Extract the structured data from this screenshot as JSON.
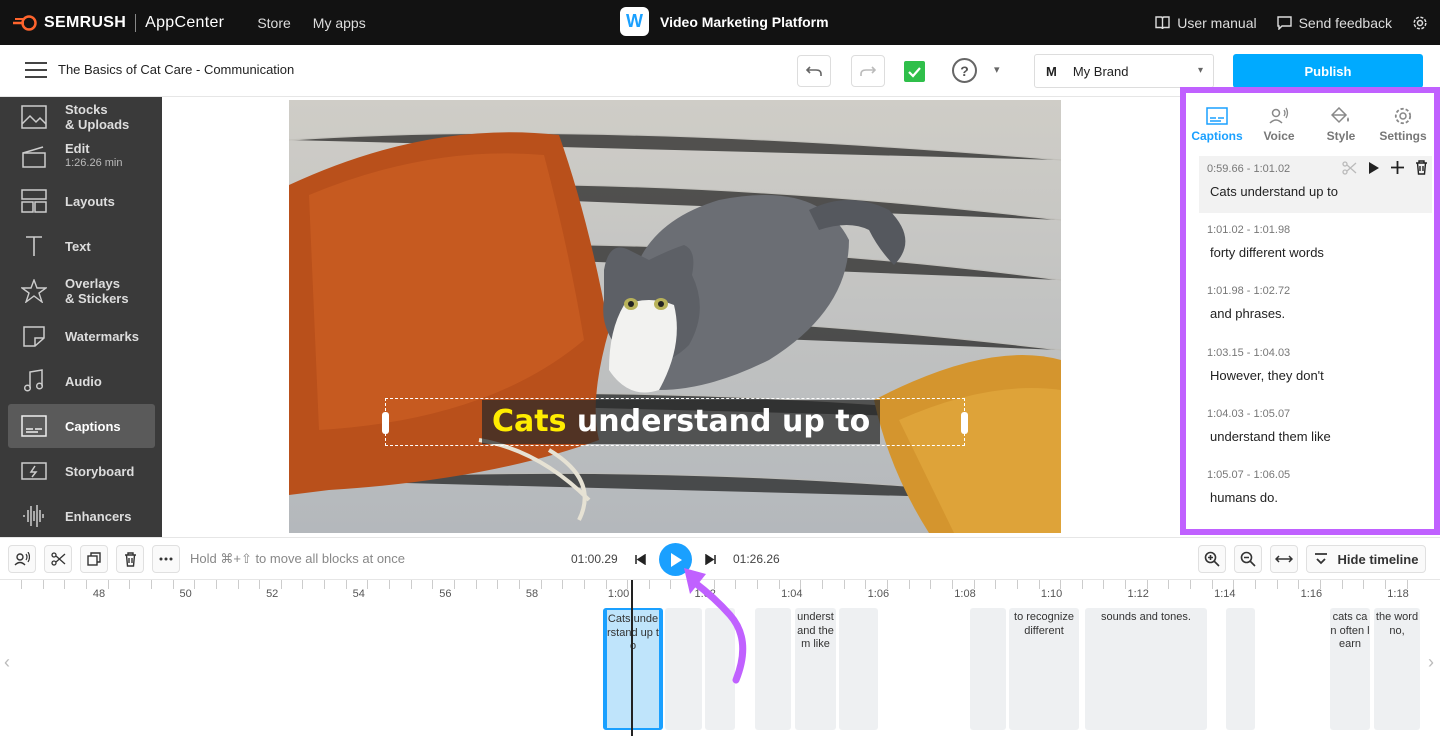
{
  "topbar": {
    "brand": "SEMRUSH",
    "appcenter": "AppCenter",
    "nav": [
      "Store",
      "My apps"
    ],
    "app_title": "Video Marketing Platform",
    "app_logo_letter": "W",
    "user_manual": "User manual",
    "send_feedback": "Send feedback"
  },
  "toolbar": {
    "project_title": "The Basics of Cat Care - Communication",
    "help": "?",
    "brand_mark": "M",
    "brand_name": "My Brand",
    "publish": "Publish"
  },
  "sidebar": {
    "items": [
      {
        "label": "Stocks",
        "label2": "& Uploads",
        "icon": "image-icon"
      },
      {
        "label": "Edit",
        "sub": "1:26.26 min",
        "icon": "clapperboard-icon"
      },
      {
        "label": "Layouts",
        "icon": "layout-icon"
      },
      {
        "label": "Text",
        "icon": "text-icon"
      },
      {
        "label": "Overlays",
        "label2": "& Stickers",
        "icon": "star-icon"
      },
      {
        "label": "Watermarks",
        "icon": "sticker-icon"
      },
      {
        "label": "Audio",
        "icon": "music-note-icon"
      },
      {
        "label": "Captions",
        "icon": "captions-icon",
        "active": true
      },
      {
        "label": "Storyboard",
        "icon": "storyboard-icon"
      },
      {
        "label": "Enhancers",
        "icon": "waveform-icon"
      }
    ]
  },
  "canvas": {
    "caption_highlight": "Cats",
    "caption_rest": " understand up to"
  },
  "right_panel": {
    "tabs": [
      {
        "label": "Captions",
        "icon": "captions-icon",
        "active": true
      },
      {
        "label": "Voice",
        "icon": "voice-icon"
      },
      {
        "label": "Style",
        "icon": "paint-bucket-icon"
      },
      {
        "label": "Settings",
        "icon": "gear-icon"
      }
    ],
    "captions": [
      {
        "time": "0:59.66 - 1:01.02",
        "text": "Cats understand up to",
        "active": true
      },
      {
        "time": "1:01.02 - 1:01.98",
        "text": "forty different words"
      },
      {
        "time": "1:01.98 - 1:02.72",
        "text": "and phrases."
      },
      {
        "time": "1:03.15 - 1:04.03",
        "text": "However, they don't"
      },
      {
        "time": "1:04.03 - 1:05.07",
        "text": "understand them like"
      },
      {
        "time": "1:05.07 - 1:06.05",
        "text": "humans do."
      }
    ]
  },
  "timeline_bar": {
    "hint": "Hold ⌘+⇧ to move all blocks at once",
    "current_time": "01:00.29",
    "total_time": "01:26.26",
    "hide_timeline": "Hide timeline"
  },
  "timeline": {
    "ruler_labels": [
      "48",
      "50",
      "52",
      "54",
      "56",
      "58",
      "1:00",
      "1:02",
      "1:04",
      "1:06",
      "1:08",
      "1:10",
      "1:12",
      "1:14",
      "1:16",
      "1:18"
    ],
    "blocks": [
      {
        "text": "Cats understand up to",
        "selected": true
      },
      {
        "text": ""
      },
      {
        "text": ""
      },
      {
        "text": ""
      },
      {
        "text": "understand them like"
      },
      {
        "text": ""
      },
      {
        "text": ""
      },
      {
        "text": "to recognize different"
      },
      {
        "text": "sounds and tones."
      },
      {
        "text": ""
      },
      {
        "text": "cats can often learn"
      },
      {
        "text": "the word no,"
      }
    ]
  },
  "colors": {
    "accent": "#1aa0ff",
    "highlight_border": "#c061ff",
    "caption_highlight": "#ffec00"
  }
}
